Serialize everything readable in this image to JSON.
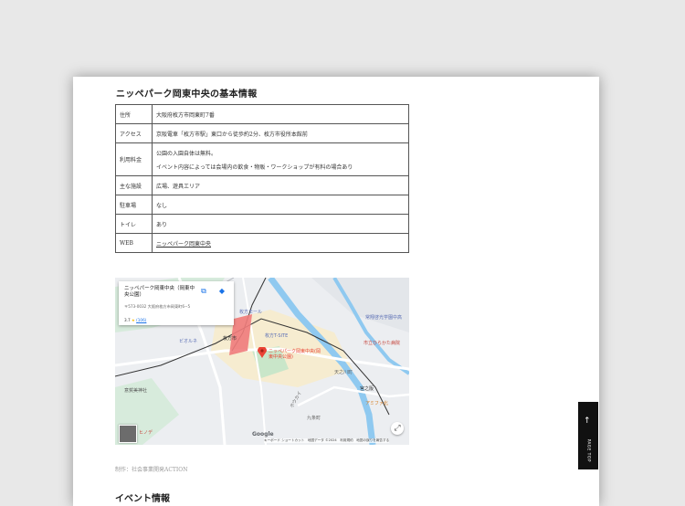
{
  "section": {
    "title": "ニッペパーク岡東中央の基本情報",
    "rows": [
      {
        "key": "住所",
        "value": "大阪府枚方市岡東町7番"
      },
      {
        "key": "アクセス",
        "value": "京阪電車「枚方市駅」東口から徒歩約2分、枚方市役所本館前"
      },
      {
        "key": "利用料金",
        "value": "公園の入園自体は無料。",
        "value2": "イベント内容によっては会場内の飲食・物販・ワークショップが有料の場合あり"
      },
      {
        "key": "主な施設",
        "value": "広場、遊具エリア"
      },
      {
        "key": "駐車場",
        "value": "なし"
      },
      {
        "key": "トイレ",
        "value": "あり"
      },
      {
        "key": "WEB",
        "value": "ニッペパーク岡東中央"
      }
    ]
  },
  "map": {
    "card_title": "ニッペパーク岡東中央（岡東中央公園）",
    "card_address": "〒573-0032 大阪府枚方市岡東町6−5",
    "rating": "3.7",
    "stars": "★",
    "reviews": "(106)",
    "pin_label": "ニッペパーク岡東中央(岡東中央公園)",
    "labels": {
      "station": "枚方市",
      "kh": "枚方T-SITE",
      "biornes": "ビオルネ",
      "mall": "枚方モール",
      "hospital": "市立ひらかた病院",
      "school": "常翔啓光学園中高",
      "shrine": "意賀美神社",
      "miyanosaka": "宮之阪",
      "bus": "アミファ北",
      "street": "ホウカイ",
      "kujo": "九条町",
      "tenno": "天之川町",
      "gf": "ヒノデ",
      "google": "Google",
      "attribution": "キーボード ショートカット　地図データ ©2024　利用規約　地図の誤りを報告する"
    },
    "accent": "#ea4335"
  },
  "credit": "制作：社会事業開発ACTION",
  "next_heading": "イベント情報",
  "page_top": "PAGE TOP"
}
